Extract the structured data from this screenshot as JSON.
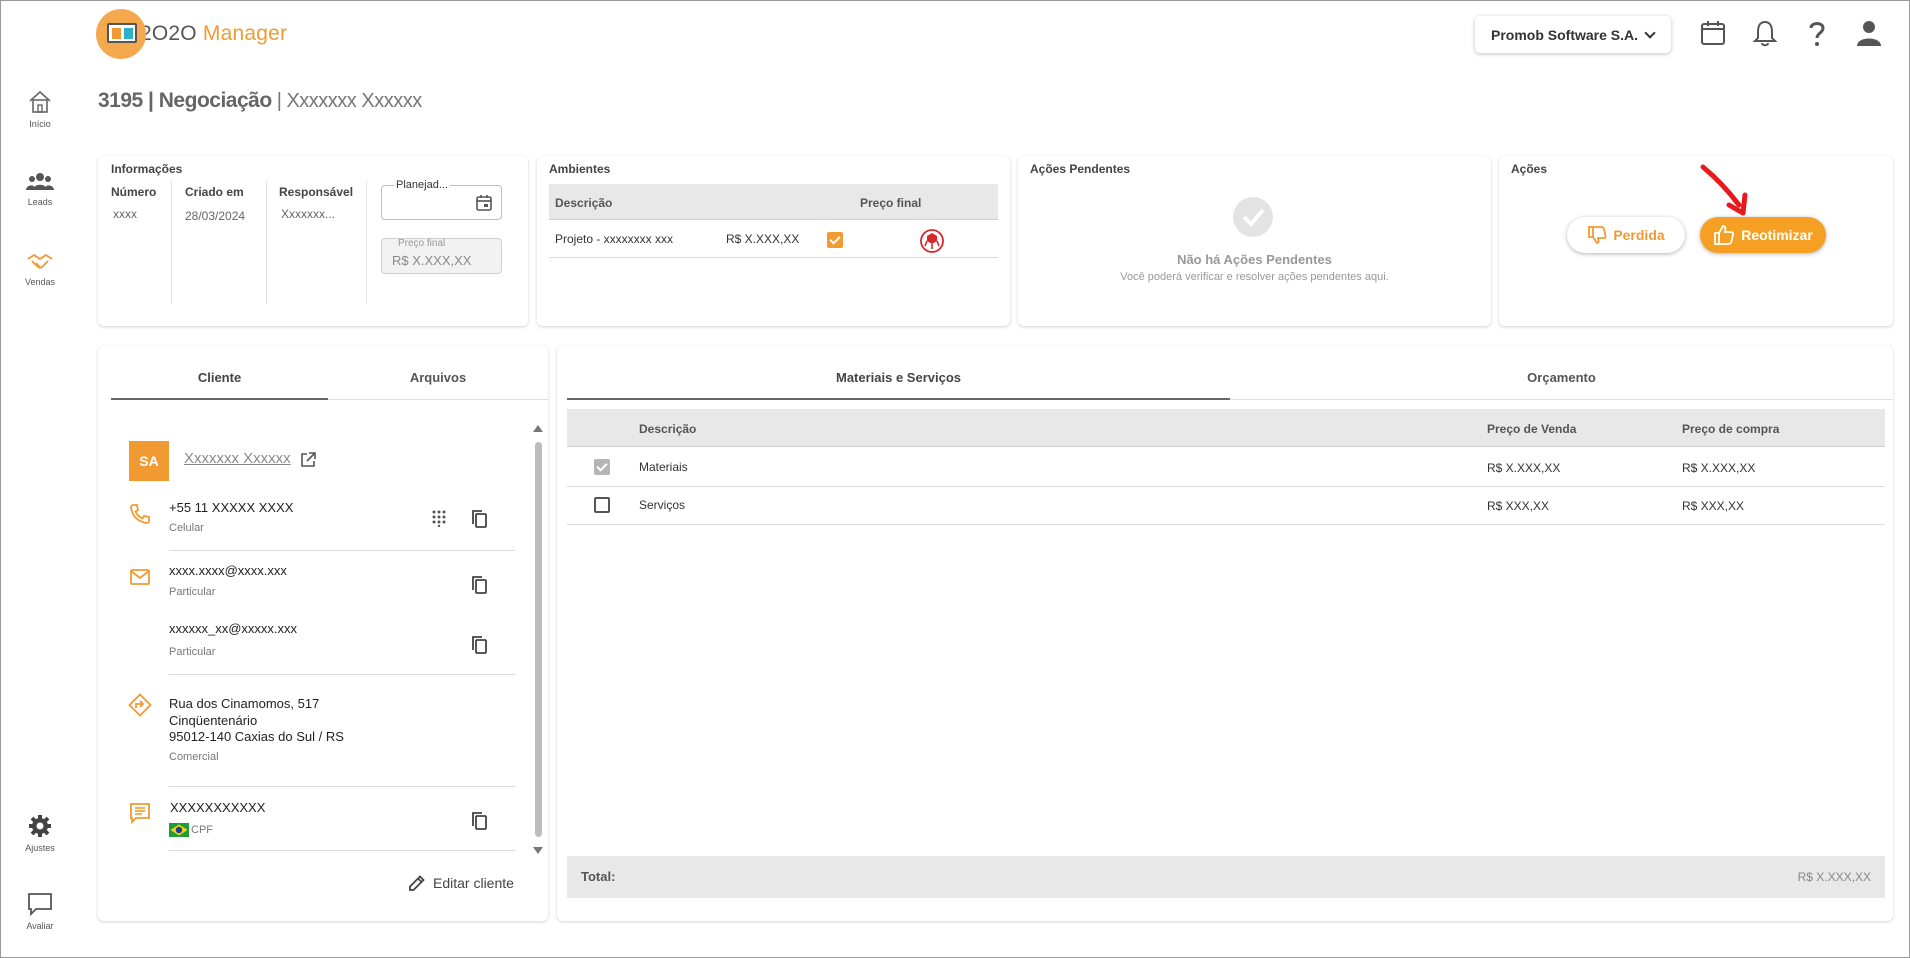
{
  "app": {
    "logo_prefix": "2O2O",
    "logo_suffix": "Manager",
    "company_selector": "Promob Software S.A."
  },
  "sidebar": {
    "items": [
      {
        "label": "Início",
        "icon": "home-icon"
      },
      {
        "label": "Leads",
        "icon": "people-icon"
      },
      {
        "label": "Vendas",
        "icon": "handshake-icon"
      },
      {
        "label": "Ajustes",
        "icon": "gear-icon"
      },
      {
        "label": "Avaliar",
        "icon": "feedback-icon"
      }
    ]
  },
  "page": {
    "title_id": "3195",
    "title_sep": " | ",
    "title_stage": "Negociação",
    "title_client": " | Xxxxxxx Xxxxxx"
  },
  "info": {
    "heading": "Informações",
    "number_label": "Número",
    "number_value": "xxxx",
    "created_label": "Criado em",
    "created_value": "28/03/2024",
    "responsible_label": "Responsável",
    "responsible_value": "Xxxxxxx...",
    "planned_label": "Planejad...",
    "final_price_label": "Preço final",
    "final_price_value": "R$ X.XXX,XX"
  },
  "environments": {
    "heading": "Ambientes",
    "col_description": "Descrição",
    "col_final_price": "Preço final",
    "row_description": "Projeto - xxxxxxxx xxx",
    "row_price": "R$ X.XXX,XX"
  },
  "pending": {
    "heading": "Ações Pendentes",
    "empty_title": "Não há Ações Pendentes",
    "empty_sub": "Você poderá verificar e resolver ações pendentes aqui."
  },
  "actions": {
    "heading": "Ações",
    "lost_label": "Perdida",
    "reoptimize_label": "Reotimizar"
  },
  "client_tabs": [
    "Cliente",
    "Arquivos"
  ],
  "client": {
    "initials": "SA",
    "name": "Xxxxxxx Xxxxxx",
    "phone": "+55 11 XXXXX XXXX",
    "phone_type": "Celular",
    "email1": "xxxx.xxxx@xxxx.xxx",
    "email1_type": "Particular",
    "email2": "xxxxxx_xx@xxxxx.xxx",
    "email2_type": "Particular",
    "address_line1": "Rua dos Cinamomos, 517",
    "address_line2": "Cinqüentenário",
    "address_line3": "95012-140 Caxias do Sul / RS",
    "address_type": "Comercial",
    "document": "XXXXXXXXXXX",
    "document_type": "CPF",
    "edit_label": "Editar cliente"
  },
  "materials_tabs": [
    "Materiais e Serviços",
    "Orçamento"
  ],
  "materials": {
    "col_description": "Descrição",
    "col_sale_price": "Preço de Venda",
    "col_buy_price": "Preço de compra",
    "rows": [
      {
        "description": "Materiais",
        "sale": "R$ X.XXX,XX",
        "buy": "R$ X.XXX,XX",
        "checked": true
      },
      {
        "description": "Serviços",
        "sale": "R$ XXX,XX",
        "buy": "R$ XXX,XX",
        "checked": false
      }
    ],
    "total_label": "Total:",
    "total_value": "R$ X.XXX,XX"
  },
  "colors": {
    "accent": "#f29a32",
    "button_primary": "#f5a023",
    "annotation_arrow": "#e8191d"
  }
}
